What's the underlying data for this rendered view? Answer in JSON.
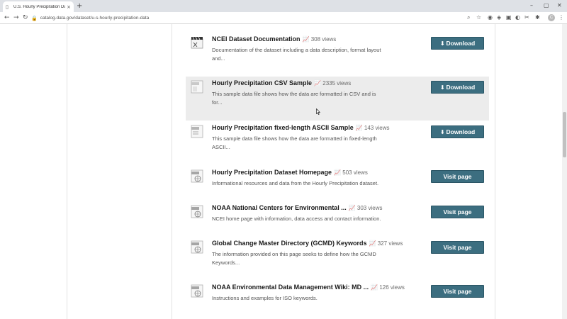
{
  "browser": {
    "tab_title": "U.S. Hourly Precipitation Data -",
    "url": "catalog.data.gov/dataset/u-s-hourly-precipitation-data",
    "profile_initial": "C"
  },
  "resources": [
    {
      "title": "NCEI Dataset Documentation",
      "views": "308 views",
      "desc_line1": "Documentation of the dataset including a data description, format layout",
      "desc_line2": "and...",
      "button": "Download",
      "button_icon": "download-icon",
      "file_icon": "document-icon"
    },
    {
      "title": "Hourly Precipitation CSV Sample",
      "views": "2335 views",
      "desc_line1": "This sample data file shows how the data are formatted in CSV and is",
      "desc_line2": "for...",
      "button": "Download",
      "button_icon": "download-icon",
      "file_icon": "csv-file-icon"
    },
    {
      "title": "Hourly Precipitation fixed-length ASCII Sample",
      "views": "143 views",
      "desc_line1": "This sample data file shows how the data are formatted in fixed-length",
      "desc_line2": "ASCII...",
      "button": "Download",
      "button_icon": "download-icon",
      "file_icon": "data-file-icon"
    },
    {
      "title": "Hourly Precipitation Dataset Homepage",
      "views": "503 views",
      "desc_line1": "Informational resources and data from the Hourly Precipitation dataset.",
      "desc_line2": "",
      "button": "Visit page",
      "button_icon": "",
      "file_icon": "html-file-icon"
    },
    {
      "title": "NOAA National Centers for Environmental ...",
      "views": "303 views",
      "desc_line1": "NCEI home page with information, data access and contact information.",
      "desc_line2": "",
      "button": "Visit page",
      "button_icon": "",
      "file_icon": "html-file-icon"
    },
    {
      "title": "Global Change Master Directory (GCMD) Keywords",
      "views": "327 views",
      "desc_line1": "The information provided on this page seeks to define how the GCMD",
      "desc_line2": "Keywords...",
      "button": "Visit page",
      "button_icon": "",
      "file_icon": "html-file-icon"
    },
    {
      "title": "NOAA Environmental Data Management Wiki: MD ...",
      "views": "126 views",
      "desc_line1": "Instructions and examples for ISO keywords.",
      "desc_line2": "",
      "button": "Visit page",
      "button_icon": "",
      "file_icon": "html-file-icon"
    }
  ],
  "colors": {
    "button_bg": "#3c6e80",
    "hover_row_bg": "#ececec"
  }
}
